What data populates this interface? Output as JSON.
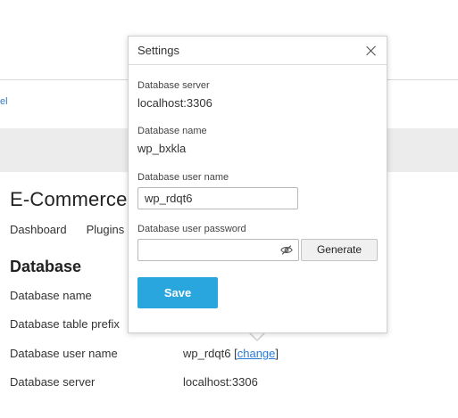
{
  "background": {
    "link_text": "el",
    "page_title": "E-Commerce",
    "tabs": [
      {
        "label": "Dashboard"
      },
      {
        "label": "Plugins"
      }
    ],
    "section_title": "Database",
    "rows": [
      {
        "label": "Database name",
        "value": ""
      },
      {
        "label": "Database table prefix",
        "value": ""
      },
      {
        "label": "Database user name",
        "value": "wp_rdqt6",
        "open_bracket": "[",
        "action": "change",
        "close_bracket": "]"
      },
      {
        "label": "Database server",
        "value": "localhost:3306"
      }
    ]
  },
  "dialog": {
    "title": "Settings",
    "close_icon": "close-icon",
    "server_label": "Database server",
    "server_value": "localhost:3306",
    "name_label": "Database name",
    "name_value": "wp_bxkla",
    "user_label": "Database user name",
    "user_value": "wp_rdqt6",
    "password_label": "Database user password",
    "password_value": "",
    "password_toggle_icon": "eye-slash-icon",
    "generate_label": "Generate",
    "save_label": "Save"
  },
  "colors": {
    "accent": "#2aa6df",
    "link": "#2b7bd6",
    "band": "#ececec"
  }
}
